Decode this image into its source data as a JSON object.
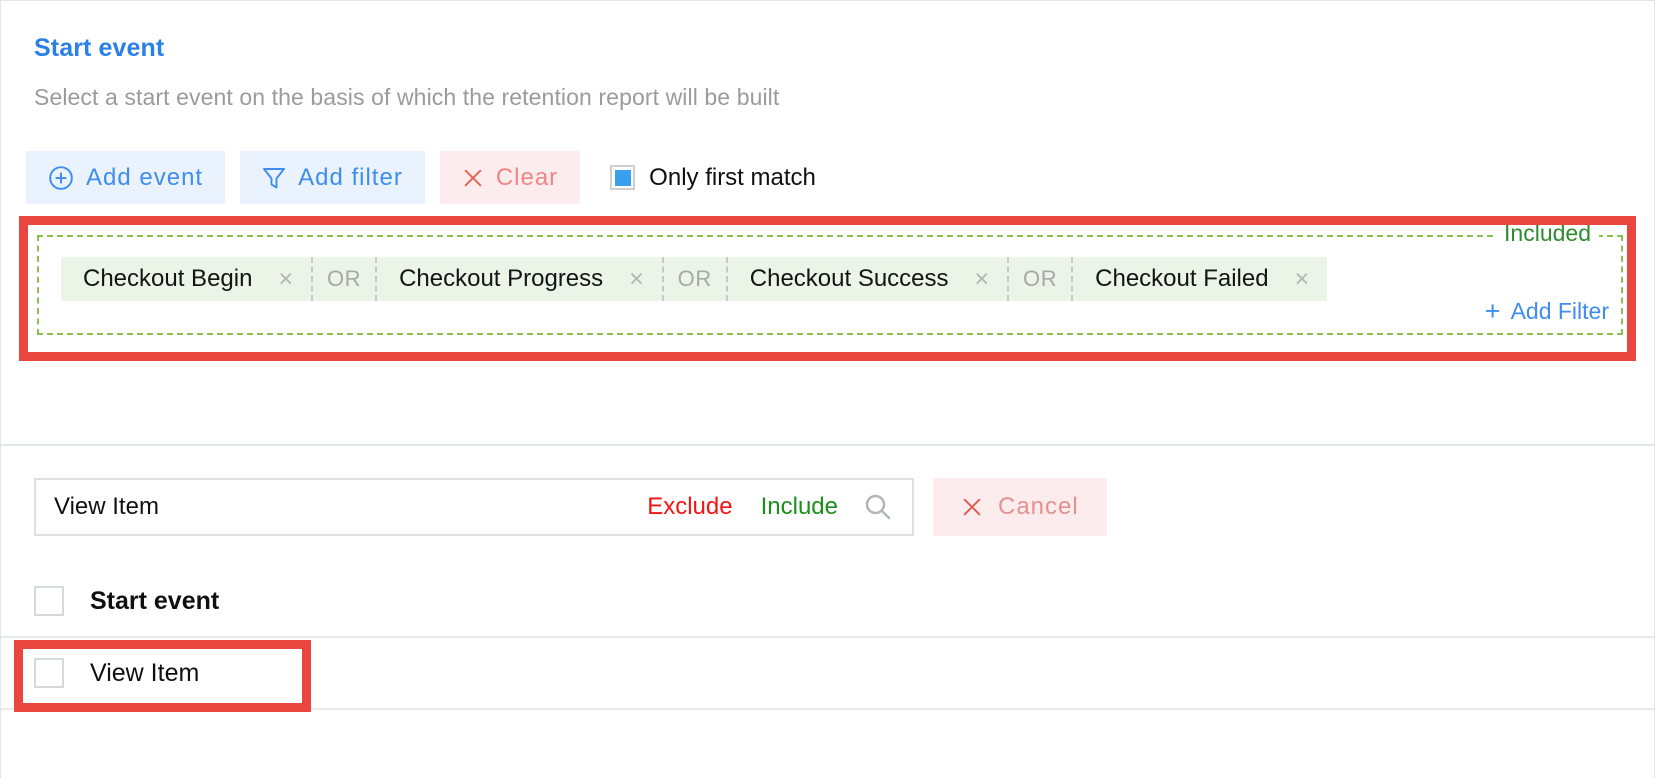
{
  "panel": {
    "title": "Start event",
    "subtitle": "Select a start event on the basis of which the retention report will be built"
  },
  "toolbar": {
    "add_event_label": "Add event",
    "add_filter_label": "Add filter",
    "clear_label": "Clear",
    "only_first_match_label": "Only first match",
    "only_first_match_checked": true,
    "icons": {
      "add_event": "plus-circle-icon",
      "add_filter": "funnel-icon",
      "clear": "close-x-icon"
    },
    "colors": {
      "blue_bg": "#eaf3fd",
      "blue_fg": "#3d8ef0",
      "red_bg": "#fdeced",
      "red_fg": "#ef8585",
      "checkbox_fill": "#39a0ef"
    }
  },
  "included_group": {
    "legend": "Included",
    "legend_color": "#2e8b30",
    "border_color": "#8cc152",
    "tag_bg": "#eaf4e7",
    "operator": "OR",
    "tags": [
      {
        "label": "Checkout Begin",
        "remove": "×"
      },
      {
        "label": "Checkout Progress",
        "remove": "×"
      },
      {
        "label": "Checkout Success",
        "remove": "×"
      },
      {
        "label": "Checkout Failed",
        "remove": "×"
      }
    ],
    "add_filter_label": "Add Filter",
    "add_filter_plus": "+"
  },
  "search": {
    "value": "View Item",
    "placeholder": "View Item",
    "exclude_label": "Exclude",
    "include_label": "Include",
    "exclude_color": "#f41414",
    "include_color": "#1b8f1b",
    "search_icon": "search-icon",
    "cancel_label": "Cancel",
    "cancel_icon": "close-x-icon"
  },
  "results": [
    {
      "label": "Start event",
      "checked": false,
      "bold": true
    },
    {
      "label": "View Item",
      "checked": false,
      "bold": false
    }
  ],
  "annotations": {
    "highlight_color": "#e8473f",
    "count": 2
  }
}
